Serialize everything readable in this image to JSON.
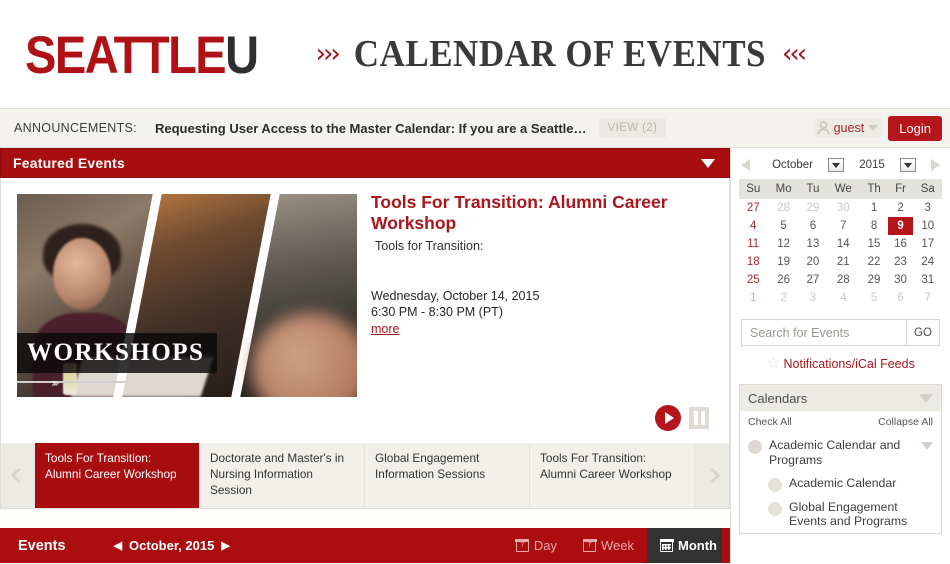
{
  "header": {
    "logo_primary": "SEATTLE",
    "logo_secondary": "U",
    "chevron_left": "›››",
    "chevron_right": "‹‹‹",
    "title": "CALENDAR OF EVENTS"
  },
  "announcement": {
    "label": "ANNOUNCEMENTS:",
    "text": "Requesting User Access to the Master Calendar: If you are a Seattle…",
    "view_label": "VIEW (2)",
    "guest_name": "guest",
    "login_label": "Login"
  },
  "featured": {
    "section_title": "Featured Events",
    "image_overlay_text": "WORKSHOPS",
    "event_title": "Tools For Transition: Alumni Career Workshop",
    "event_subtitle": "Tools for Transition:",
    "event_date": "Wednesday, October 14, 2015",
    "event_time": "6:30 PM - 8:30 PM (PT)",
    "more_label": "more"
  },
  "carousel": {
    "items": [
      {
        "label": "Tools For Transition: Alumni Career Workshop",
        "active": true
      },
      {
        "label": "Doctorate and Master's in Nursing Information Session",
        "active": false
      },
      {
        "label": "Global Engagement Information Sessions",
        "active": false
      },
      {
        "label": "Tools For Transition: Alumni Career Workshop",
        "active": false
      }
    ]
  },
  "mini_calendar": {
    "month": "October",
    "year": "2015",
    "weekday_headers": [
      "Su",
      "Mo",
      "Tu",
      "We",
      "Th",
      "Fr",
      "Sa"
    ],
    "weeks": [
      [
        {
          "d": "27",
          "type": "sun"
        },
        {
          "d": "28",
          "type": "out"
        },
        {
          "d": "29",
          "type": "out"
        },
        {
          "d": "30",
          "type": "out"
        },
        {
          "d": "1",
          "type": "in"
        },
        {
          "d": "2",
          "type": "in"
        },
        {
          "d": "3",
          "type": "in"
        }
      ],
      [
        {
          "d": "4",
          "type": "sun"
        },
        {
          "d": "5",
          "type": "in"
        },
        {
          "d": "6",
          "type": "in"
        },
        {
          "d": "7",
          "type": "in"
        },
        {
          "d": "8",
          "type": "in"
        },
        {
          "d": "9",
          "type": "today"
        },
        {
          "d": "10",
          "type": "in"
        }
      ],
      [
        {
          "d": "11",
          "type": "sun"
        },
        {
          "d": "12",
          "type": "in"
        },
        {
          "d": "13",
          "type": "in"
        },
        {
          "d": "14",
          "type": "in"
        },
        {
          "d": "15",
          "type": "in"
        },
        {
          "d": "16",
          "type": "in"
        },
        {
          "d": "17",
          "type": "in"
        }
      ],
      [
        {
          "d": "18",
          "type": "sun"
        },
        {
          "d": "19",
          "type": "in"
        },
        {
          "d": "20",
          "type": "in"
        },
        {
          "d": "21",
          "type": "in"
        },
        {
          "d": "22",
          "type": "in"
        },
        {
          "d": "23",
          "type": "in"
        },
        {
          "d": "24",
          "type": "in"
        }
      ],
      [
        {
          "d": "25",
          "type": "sun"
        },
        {
          "d": "26",
          "type": "in"
        },
        {
          "d": "27",
          "type": "in"
        },
        {
          "d": "28",
          "type": "in"
        },
        {
          "d": "29",
          "type": "in"
        },
        {
          "d": "30",
          "type": "in"
        },
        {
          "d": "31",
          "type": "in"
        }
      ],
      [
        {
          "d": "1",
          "type": "sun out"
        },
        {
          "d": "2",
          "type": "out"
        },
        {
          "d": "3",
          "type": "out"
        },
        {
          "d": "4",
          "type": "out"
        },
        {
          "d": "5",
          "type": "out"
        },
        {
          "d": "6",
          "type": "out"
        },
        {
          "d": "7",
          "type": "out"
        }
      ]
    ]
  },
  "search": {
    "placeholder": "Search for Events",
    "value": "",
    "go_label": "GO"
  },
  "notifications": {
    "link_label": "Notifications/iCal Feeds"
  },
  "calendars_panel": {
    "title": "Calendars",
    "check_all_label": "Check All",
    "collapse_all_label": "Collapse All",
    "items": [
      {
        "label": "Academic Calendar and Programs",
        "level": 0,
        "expandable": true
      },
      {
        "label": "Academic Calendar",
        "level": 1,
        "expandable": false
      },
      {
        "label": "Global Engagement Events and Programs",
        "level": 1,
        "expandable": false
      }
    ]
  },
  "events_bar": {
    "title": "Events",
    "period": "October, 2015",
    "prev_arrow": "◀",
    "next_arrow": "▶",
    "views": [
      {
        "label": "Day",
        "active": false,
        "icon": "calendar-day-icon"
      },
      {
        "label": "Week",
        "active": false,
        "icon": "calendar-week-icon"
      },
      {
        "label": "Month",
        "active": true,
        "icon": "calendar-month-icon"
      }
    ]
  },
  "colors": {
    "brand_red": "#a80d10",
    "logo_red": "#b01116",
    "login_red": "#b4161b",
    "today_red": "#b5141a",
    "dark_tab": "#333333",
    "panel_bg": "#f3f2ee"
  }
}
